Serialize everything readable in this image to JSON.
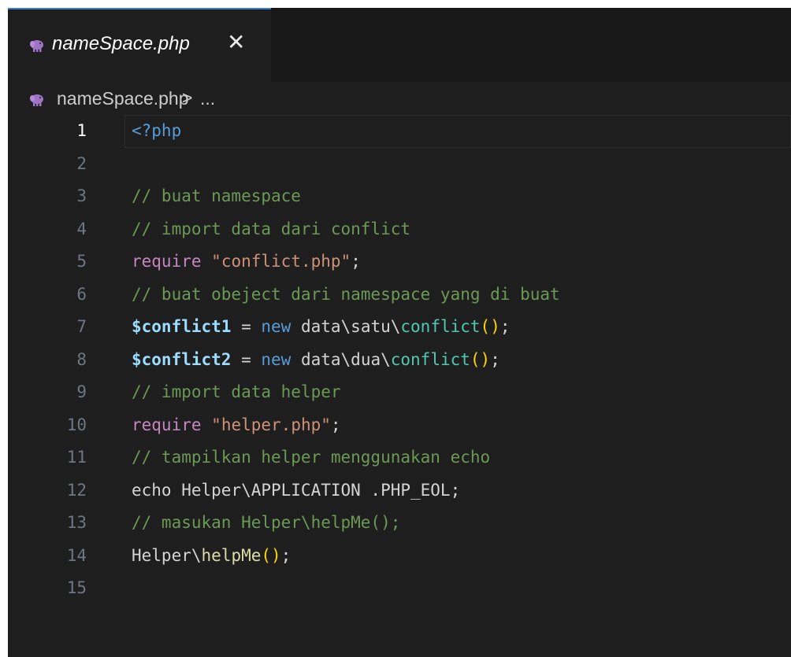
{
  "tab": {
    "label": "nameSpace.php",
    "close": "✕",
    "icon": "php-elephant-icon"
  },
  "breadcrumb": {
    "file": "nameSpace.php",
    "separator": ">",
    "more": "..."
  },
  "colors": {
    "accent": "#3c7fc4",
    "icon": "#a074c4",
    "comment": "#6a9955",
    "keyword": "#c586c0",
    "string": "#ce9178",
    "variable": "#9cdcfe",
    "new": "#569cd6",
    "bracket": "#ffd700"
  },
  "editor": {
    "active_line": 1,
    "line_numbers": [
      "1",
      "2",
      "3",
      "4",
      "5",
      "6",
      "7",
      "8",
      "9",
      "10",
      "11",
      "12",
      "13",
      "14",
      "15"
    ],
    "lines": [
      [
        {
          "t": "tag",
          "v": "<?php"
        }
      ],
      [],
      [
        {
          "t": "comment",
          "v": "// buat namespace"
        }
      ],
      [
        {
          "t": "comment",
          "v": "// import data dari conflict"
        }
      ],
      [
        {
          "t": "kw",
          "v": "require"
        },
        {
          "t": "plain",
          "v": " "
        },
        {
          "t": "str",
          "v": "\"conflict.php\""
        },
        {
          "t": "plain",
          "v": ";"
        }
      ],
      [
        {
          "t": "comment",
          "v": "// buat obeject dari namespace yang di buat"
        }
      ],
      [
        {
          "t": "var",
          "v": "$conflict1"
        },
        {
          "t": "plain",
          "v": " = "
        },
        {
          "t": "new",
          "v": "new"
        },
        {
          "t": "plain",
          "v": " data\\satu\\"
        },
        {
          "t": "fn",
          "v": "conflict"
        },
        {
          "t": "paren",
          "v": "()"
        },
        {
          "t": "plain",
          "v": ";"
        }
      ],
      [
        {
          "t": "var",
          "v": "$conflict2"
        },
        {
          "t": "plain",
          "v": " = "
        },
        {
          "t": "new",
          "v": "new"
        },
        {
          "t": "plain",
          "v": " data\\dua\\"
        },
        {
          "t": "fn",
          "v": "conflict"
        },
        {
          "t": "paren",
          "v": "()"
        },
        {
          "t": "plain",
          "v": ";"
        }
      ],
      [
        {
          "t": "comment",
          "v": "// import data helper"
        }
      ],
      [
        {
          "t": "kw",
          "v": "require"
        },
        {
          "t": "plain",
          "v": " "
        },
        {
          "t": "str",
          "v": "\"helper.php\""
        },
        {
          "t": "plain",
          "v": ";"
        }
      ],
      [
        {
          "t": "comment",
          "v": "// tampilkan helper menggunakan echo"
        }
      ],
      [
        {
          "t": "plain",
          "v": "echo Helper\\APPLICATION .PHP_EOL;"
        }
      ],
      [
        {
          "t": "comment",
          "v": "// masukan Helper\\helpMe();"
        }
      ],
      [
        {
          "t": "plain",
          "v": "Helper\\"
        },
        {
          "t": "fnname",
          "v": "helpMe"
        },
        {
          "t": "paren",
          "v": "()"
        },
        {
          "t": "plain",
          "v": ";"
        }
      ],
      []
    ]
  }
}
